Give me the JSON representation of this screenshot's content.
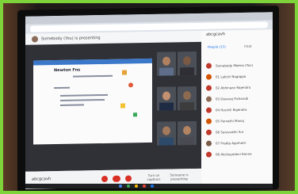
{
  "frame_color": "#7fd33a",
  "meeting": {
    "presenting_label": "Somebody (You) is presenting",
    "code": "abcgcavh",
    "captions_label": "Turn on captions",
    "present_label": "Someone is presenting"
  },
  "panel": {
    "user_name": "abcgcavh",
    "tab_people": "People (13)",
    "tab_chat": "Chat",
    "participants": [
      "Somebody Meena (You)",
      "01 Lakshi Nagappa",
      "02 Abhinaav Rajendra",
      "03 Devaraj Pisharodi",
      "04 Harshil Rajendra",
      "05 Parvathi Manoj",
      "06 Sarasvathi Sur",
      "07 Pradip Agnihotri",
      "08 Akshayadevi Kanna"
    ]
  },
  "slide": {
    "title": "Newton Fns"
  }
}
